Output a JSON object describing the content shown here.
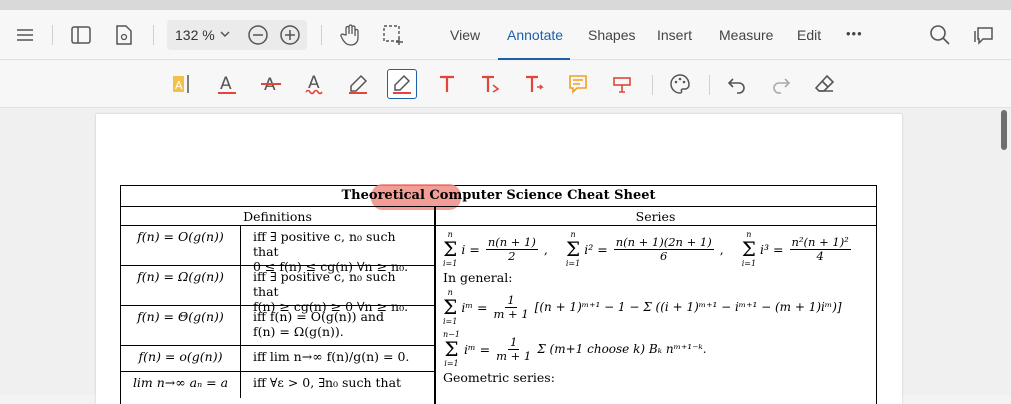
{
  "toolbar": {
    "zoom_value": "132 %",
    "menu": [
      "View",
      "Annotate",
      "Shapes",
      "Insert",
      "Measure",
      "Edit"
    ],
    "active_menu": "Annotate",
    "more_label": "•••"
  },
  "document": {
    "title": "Theoretical Computer Science Cheat Sheet",
    "highlighted_word": "Theoretical",
    "col_headers": {
      "left": "Definitions",
      "right": "Series"
    },
    "definitions": [
      {
        "lhs": "f(n) = O(g(n))",
        "rhs": [
          "iff ∃ positive c, n₀ such that",
          "0 ≤ f(n) ≤ cg(n) ∀n ≥ n₀."
        ]
      },
      {
        "lhs": "f(n) = Ω(g(n))",
        "rhs": [
          "iff ∃ positive c, n₀ such that",
          "f(n) ≥ cg(n) ≥ 0 ∀n ≥ n₀."
        ]
      },
      {
        "lhs": "f(n) = Θ(g(n))",
        "rhs": [
          "iff  f(n)  =  O(g(n))  and",
          "f(n) = Ω(g(n))."
        ]
      },
      {
        "lhs": "f(n) = o(g(n))",
        "rhs": [
          "iff lim n→∞ f(n)/g(n) = 0."
        ]
      },
      {
        "lhs": "lim n→∞ aₙ = a",
        "rhs": [
          "iff ∀ε > 0, ∃n₀ such that"
        ]
      }
    ],
    "series": {
      "sum_i": "i =",
      "sum_i_num": "n(n + 1)",
      "sum_i_den": "2",
      "sum_i2": "i² =",
      "sum_i2_num": "n(n + 1)(2n + 1)",
      "sum_i2_den": "6",
      "sum_i3": "i³ =",
      "sum_i3_num": "n²(n + 1)²",
      "sum_i3_den": "4",
      "in_general": "In general:",
      "gen1_lhs": "iᵐ =",
      "gen1_frac_num": "1",
      "gen1_frac_den": "m + 1",
      "gen1_rest": "[(n + 1)ᵐ⁺¹ − 1 − Σ ((i + 1)ᵐ⁺¹ − iᵐ⁺¹ − (m + 1)iᵐ)]",
      "gen2_lhs": "iᵐ =",
      "gen2_frac_num": "1",
      "gen2_frac_den": "m + 1",
      "gen2_rest": "Σ (m+1 choose k) Bₖ nᵐ⁺¹⁻ᵏ.",
      "geometric": "Geometric series:"
    }
  }
}
